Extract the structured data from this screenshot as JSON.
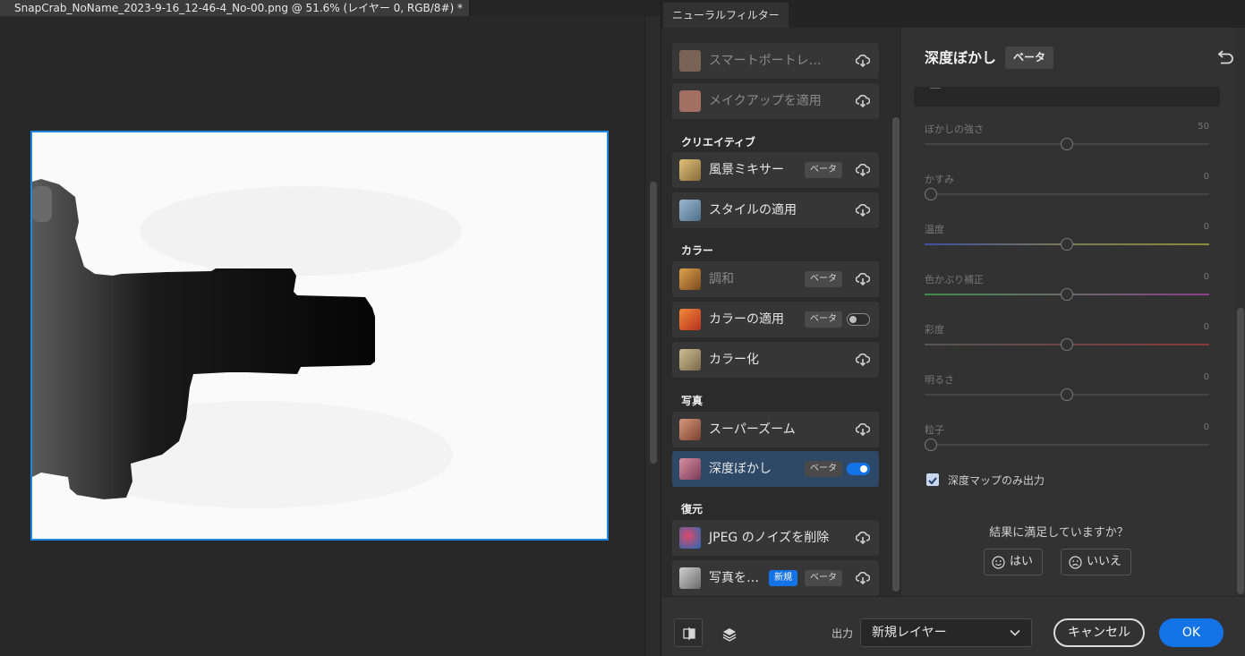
{
  "document": {
    "tab_title": "SnapCrab_NoName_2023-9-16_12-46-4_No-00.png @ 51.6% (レイヤー 0, RGB/8#) *"
  },
  "panel": {
    "tab_label": "ニューラルフィルター"
  },
  "filter_list": {
    "items_top": [
      {
        "label": "スマートポートレ…",
        "dim": true,
        "thumb_icon": "portrait-thumb",
        "thumb_color": "#8a6f5e",
        "action": "cloud-download-icon"
      },
      {
        "label": "メイクアップを適用",
        "dim": true,
        "thumb_icon": "makeup-thumb",
        "thumb_color": "#b07a6a",
        "action": "cloud-download-icon"
      }
    ],
    "categories": [
      {
        "label": "クリエイティブ",
        "items": [
          {
            "label": "風景ミキサー",
            "badge": "ベータ",
            "thumb_icon": "landscape-thumb",
            "thumb_color": "#c9a65a",
            "action": "cloud-download-icon"
          },
          {
            "label": "スタイルの適用",
            "thumb_icon": "style-thumb",
            "thumb_color": "#7d9bb8",
            "action": "cloud-download-icon"
          }
        ]
      },
      {
        "label": "カラー",
        "items": [
          {
            "label": "調和",
            "badge": "ベータ",
            "dim": true,
            "thumb_icon": "harmony-thumb",
            "thumb_color": "#c98a3a",
            "action": "cloud-download-icon"
          },
          {
            "label": "カラーの適用",
            "badge": "ベータ",
            "thumb_icon": "color-transfer-thumb",
            "thumb_color": "#d0502e",
            "action": "toggle-off"
          },
          {
            "label": "カラー化",
            "thumb_icon": "colorize-thumb",
            "thumb_color": "#b4a27a",
            "action": "cloud-download-icon"
          }
        ]
      },
      {
        "label": "写真",
        "items": [
          {
            "label": "スーパーズーム",
            "thumb_icon": "superzoom-thumb",
            "thumb_color": "#b9755e",
            "action": "cloud-download-icon"
          },
          {
            "label": "深度ぼかし",
            "badge": "ベータ",
            "selected": true,
            "thumb_icon": "depth-blur-thumb",
            "thumb_color": "#b86a7a",
            "action": "toggle-on"
          }
        ]
      },
      {
        "label": "復元",
        "items": [
          {
            "label": "JPEG のノイズを削除",
            "thumb_icon": "jpeg-noise-thumb",
            "thumb_color": "#3a7fc4",
            "action": "cloud-download-icon"
          },
          {
            "label": "写真を…",
            "badge_new": "新規",
            "badge": "ベータ",
            "thumb_icon": "photo-restore-thumb",
            "thumb_color": "#9a9a9a",
            "action": "cloud-download-icon"
          }
        ]
      }
    ]
  },
  "settings": {
    "title": "深度ぼかし",
    "badge": "ベータ",
    "sliders": [
      {
        "label": "ぼかしの強さ",
        "value": "50",
        "pos": 0.5,
        "track_color": "#454545"
      },
      {
        "label": "かすみ",
        "value": "0",
        "pos": 0.0,
        "track_color": "#454545"
      },
      {
        "label": "温度",
        "value": "0",
        "pos": 0.5,
        "track_color": "gradient-blue-yellow"
      },
      {
        "label": "色かぶり補正",
        "value": "0",
        "pos": 0.5,
        "track_color": "gradient-green-magenta"
      },
      {
        "label": "彩度",
        "value": "0",
        "pos": 0.5,
        "track_color": "gradient-gray-red"
      },
      {
        "label": "明るさ",
        "value": "0",
        "pos": 0.5,
        "track_color": "#454545"
      },
      {
        "label": "粒子",
        "value": "0",
        "pos": 0.0,
        "track_color": "#454545"
      }
    ],
    "checkbox_label": "深度マップのみ出力",
    "checkbox_checked": true,
    "feedback_question": "結果に満足していますか？",
    "feedback_yes": "はい",
    "feedback_no": "いいえ"
  },
  "footer": {
    "output_label": "出力",
    "output_value": "新規レイヤー",
    "cancel_label": "キャンセル",
    "ok_label": "OK"
  },
  "colors": {
    "accent": "#1473e6",
    "selected_item": "#2e4868",
    "canvas_border": "#1c86e0"
  }
}
